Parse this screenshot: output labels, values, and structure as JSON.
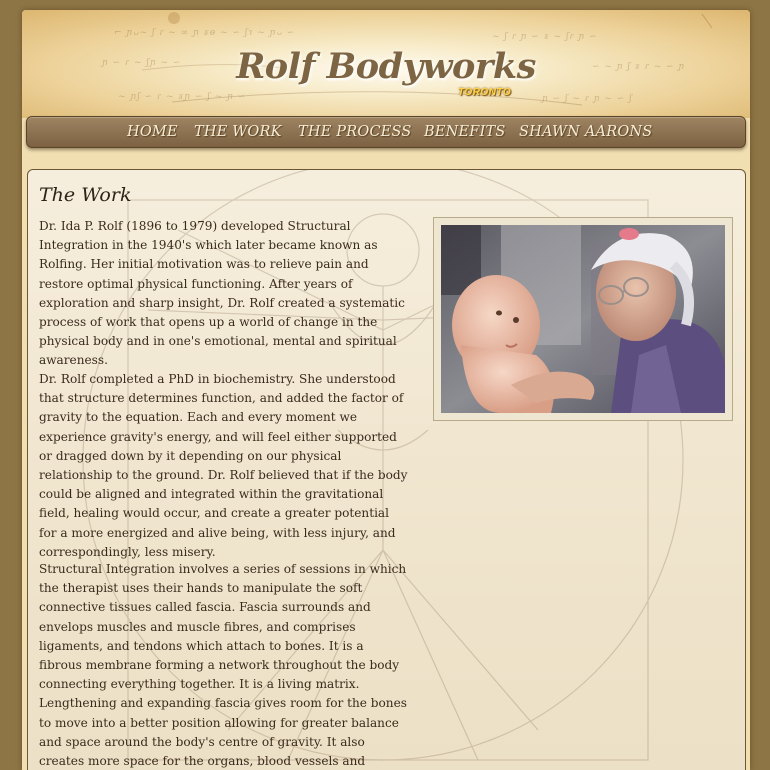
{
  "header": {
    "title": "Rolf Bodyworks",
    "subtitle": "TORONTO"
  },
  "nav": {
    "items": [
      {
        "label": "HOME"
      },
      {
        "label": "THE WORK"
      },
      {
        "label": "THE PROCESS"
      },
      {
        "label": "BENEFITS"
      },
      {
        "label": "SHAWN AARONS"
      }
    ]
  },
  "main": {
    "title": "The Work",
    "paragraphs": [
      "Dr. Ida P. Rolf (1896 to 1979) developed Structural Integration in the 1940's which later became known as Rolfing. Her initial motivation was to relieve pain and restore optimal physical functioning. After years of exploration and sharp insight, Dr. Rolf created a systematic process of work that opens up a world of change in the physical body and in one's emotional, mental and spiritual awareness.",
      "Dr. Rolf completed a PhD in biochemistry. She understood that structure determines function, and added the factor of gravity to the equation. Each and every moment we experience gravity's energy, and will feel either supported or dragged down by it depending on our physical relationship to the ground. Dr. Rolf believed that if the body could be aligned and integrated within the gravitational field, healing would occur, and create a greater potential for a more energized and alive being, with less injury, and correspondingly, less misery.",
      "Structural Integration involves a series of sessions in which the therapist uses their hands to manipulate the soft connective tissues called fascia. Fascia surrounds and envelops muscles and muscle fibres, and comprises ligaments, and tendons which attach to bones. It is a fibrous membrane forming a network throughout the body connecting everything together. It is a living matrix. Lengthening and expanding fascia gives room for the bones to move into a better position allowing for greater balance and space around the body's centre of gravity. It also creates more space for the organs, blood vessels and nerves thus improving overall physiological functioning."
    ]
  },
  "colors": {
    "background": "#8e7545",
    "nav_bar": "#8a6f4f",
    "title_text": "#7d6443",
    "accent_gold": "#ffd24a"
  }
}
